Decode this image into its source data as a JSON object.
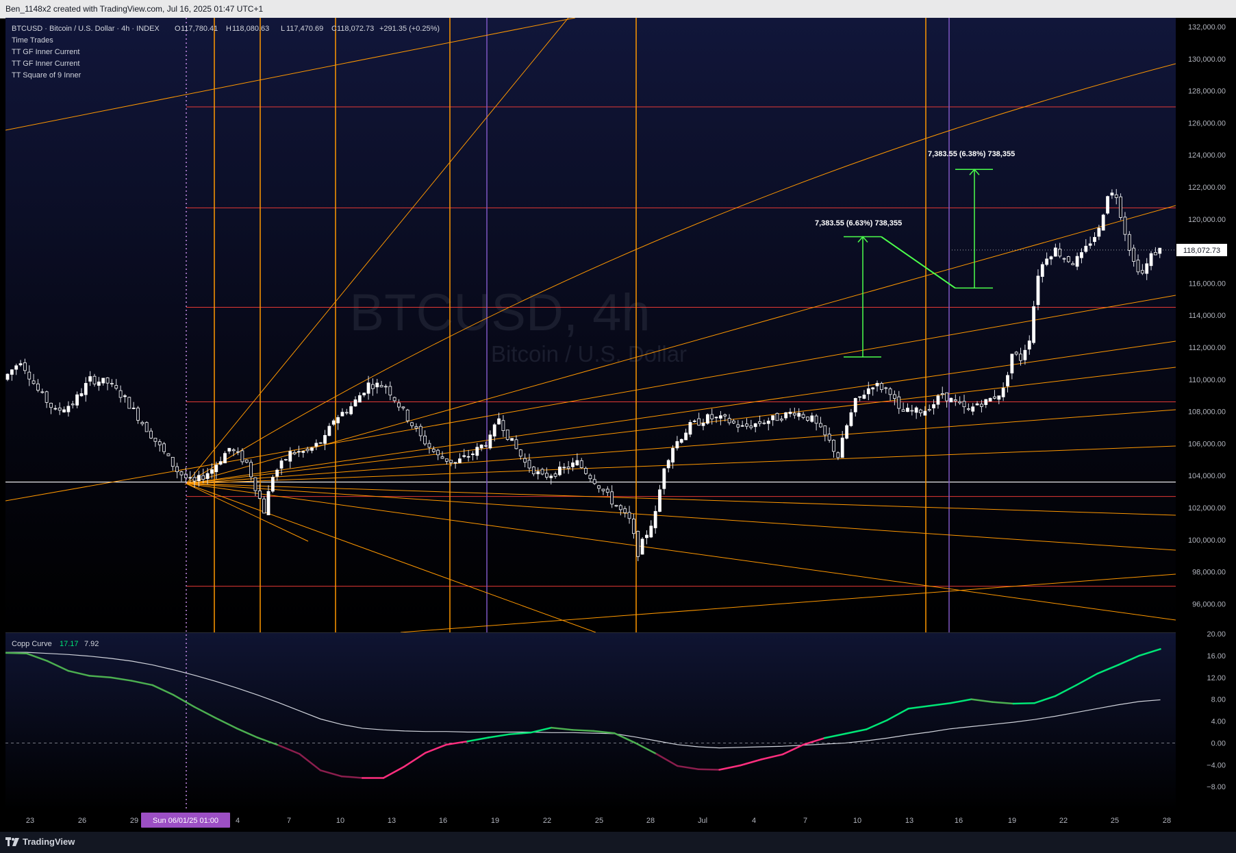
{
  "header": {
    "text": "Ben_1148x2 created with TradingView.com, Jul 16, 2025 01:47 UTC+1"
  },
  "legend": {
    "symbol": "BTCUSD · Bitcoin / U.S. Dollar · 4h · INDEX",
    "open_label": "O",
    "open": "117,780.41",
    "high_label": "H",
    "high": "118,080.63",
    "low_label": "L",
    "low": "117,470.69",
    "close_label": "C",
    "close": "118,072.73",
    "change": "+291.35 (+0.25%)",
    "indicators": [
      "Time Trades",
      "TT GF Inner Current",
      "TT GF Inner Current",
      "TT Square of 9 Inner"
    ]
  },
  "watermark": {
    "symbol": "BTCUSD, 4h",
    "name": "Bitcoin / U.S. Dollar"
  },
  "footer": {
    "brand": "TradingView"
  },
  "colors": {
    "background": "#000000",
    "orange": "#ff9800",
    "red_level": "#e53935",
    "purple_line": "#7e57c2",
    "green_measure": "#4cff4c",
    "copp_green": "#00e676",
    "copp_red": "#ff2e7e",
    "signal": "#d1d4dc"
  },
  "chart_data": [
    {
      "type": "candlestick",
      "title": "BTCUSD, 4h",
      "ylim": [
        94000,
        133000
      ],
      "yticks": [
        "132,000.00",
        "130,000.00",
        "128,000.00",
        "126,000.00",
        "124,000.00",
        "122,000.00",
        "120,000.00",
        "118,000.00",
        "116,000.00",
        "114,000.00",
        "112,000.00",
        "110,000.00",
        "108,000.00",
        "106,000.00",
        "104,000.00",
        "102,000.00",
        "100,000.00",
        "98,000.00",
        "96,000.00"
      ],
      "last_price": 118072.73,
      "last_price_label": "118,072.73",
      "x_labels": [
        "23",
        "26",
        "29",
        "Sun 06/01/25   01:00",
        "4",
        "7",
        "10",
        "13",
        "16",
        "19",
        "22",
        "25",
        "28",
        "Jul",
        "4",
        "7",
        "10",
        "13",
        "16",
        "19",
        "22",
        "25",
        "28"
      ],
      "anchor": {
        "date": "Sun 06/01/25 01:00",
        "price": 103500
      },
      "price_path": [
        [
          0,
          110000
        ],
        [
          4,
          111200
        ],
        [
          8,
          109300
        ],
        [
          12,
          108000
        ],
        [
          16,
          108500
        ],
        [
          20,
          110000
        ],
        [
          24,
          109800
        ],
        [
          28,
          108800
        ],
        [
          32,
          107300
        ],
        [
          36,
          105800
        ],
        [
          40,
          104300
        ],
        [
          43.7,
          103500
        ],
        [
          48,
          104400
        ],
        [
          52,
          105700
        ],
        [
          56,
          104800
        ],
        [
          60,
          101800
        ],
        [
          62,
          104000
        ],
        [
          66,
          105400
        ],
        [
          70,
          105500
        ],
        [
          74,
          106300
        ],
        [
          76,
          107500
        ],
        [
          80,
          108300
        ],
        [
          84,
          109700
        ],
        [
          88,
          109600
        ],
        [
          92,
          108000
        ],
        [
          96,
          106400
        ],
        [
          100,
          105200
        ],
        [
          104,
          104800
        ],
        [
          108,
          105400
        ],
        [
          112,
          106300
        ],
        [
          114,
          107600
        ],
        [
          116,
          106500
        ],
        [
          120,
          104800
        ],
        [
          124,
          103900
        ],
        [
          128,
          104300
        ],
        [
          132,
          104800
        ],
        [
          136,
          103700
        ],
        [
          140,
          102400
        ],
        [
          144,
          101200
        ],
        [
          146,
          99200
        ],
        [
          150,
          101600
        ],
        [
          152,
          104600
        ],
        [
          154,
          105800
        ],
        [
          158,
          107100
        ],
        [
          162,
          107600
        ],
        [
          166,
          107500
        ],
        [
          170,
          107000
        ],
        [
          174,
          107300
        ],
        [
          178,
          107600
        ],
        [
          182,
          108000
        ],
        [
          186,
          107500
        ],
        [
          190,
          106100
        ],
        [
          192,
          105200
        ],
        [
          194,
          107100
        ],
        [
          196,
          108600
        ],
        [
          200,
          109700
        ],
        [
          204,
          109300
        ],
        [
          206,
          108000
        ],
        [
          210,
          108000
        ],
        [
          212,
          108100
        ],
        [
          214,
          108500
        ],
        [
          216,
          109100
        ],
        [
          218,
          108700
        ],
        [
          222,
          108000
        ],
        [
          224,
          108500
        ],
        [
          226,
          108600
        ],
        [
          230,
          109300
        ],
        [
          232,
          111600
        ],
        [
          234,
          111300
        ],
        [
          236,
          112600
        ],
        [
          238,
          116600
        ],
        [
          240,
          117700
        ],
        [
          242,
          118100
        ],
        [
          244,
          117600
        ],
        [
          246,
          117300
        ],
        [
          248,
          117700
        ],
        [
          250,
          118600
        ],
        [
          252,
          119300
        ],
        [
          254,
          121600
        ],
        [
          256,
          121500
        ],
        [
          258,
          119200
        ],
        [
          260,
          117300
        ],
        [
          262,
          116600
        ],
        [
          264,
          117700
        ],
        [
          265.6,
          118072
        ]
      ],
      "levels_red": [
        127000,
        120700,
        114500,
        108600,
        102700,
        97100
      ],
      "level_white": 103600,
      "vertical_orange_dates": [
        62,
        57,
        74,
        96,
        146,
        210
      ],
      "vertical_orange_x_idx": [
        8.0,
        18.0,
        34.0,
        95.0,
        135.0,
        255.0
      ],
      "vertical_purple_x_idx": [
        103.0,
        260.5
      ],
      "measure_1": {
        "label": "7,383.55 (6.63%) 738,355",
        "from_price": 111400,
        "to_price": 118900
      },
      "measure_2": {
        "label": "7,383.55 (6.38%) 738,355",
        "from_price": 115700,
        "to_price": 123100
      }
    },
    {
      "type": "line",
      "title": "Copp Curve",
      "values_label": [
        "17.17",
        "7.92"
      ],
      "ylim": [
        -10,
        20
      ],
      "yticks": [
        "20.00",
        "16.00",
        "12.00",
        "8.00",
        "4.00",
        "0.00",
        "−4.00",
        "−8.00"
      ],
      "series": [
        {
          "name": "Copp Curve",
          "values": [
            16.5,
            16.4,
            15.0,
            13.2,
            12.3,
            12.0,
            11.4,
            10.6,
            8.8,
            6.6,
            4.6,
            2.7,
            1.0,
            -0.4,
            -2.0,
            -5.0,
            -6.1,
            -6.4,
            -6.4,
            -4.3,
            -1.8,
            -0.3,
            0.3,
            1.0,
            1.6,
            1.9,
            2.8,
            2.4,
            2.2,
            1.8,
            0.0,
            -2.0,
            -4.2,
            -4.8,
            -4.9,
            -4.1,
            -3.0,
            -2.1,
            -0.3,
            0.9,
            1.7,
            2.5,
            4.2,
            6.3,
            6.8,
            7.3,
            8.0,
            7.5,
            7.2,
            7.3,
            8.6,
            10.6,
            12.7,
            14.3,
            16.0,
            17.2
          ]
        },
        {
          "name": "Signal",
          "values": [
            16.6,
            16.6,
            16.4,
            16.2,
            15.9,
            15.5,
            15.0,
            14.3,
            13.4,
            12.4,
            11.3,
            10.1,
            8.8,
            7.4,
            5.9,
            4.4,
            3.4,
            2.7,
            2.4,
            2.2,
            2.1,
            2.1,
            2.0,
            2.0,
            2.0,
            2.0,
            1.9,
            1.9,
            1.8,
            1.7,
            1.1,
            0.4,
            -0.3,
            -0.7,
            -0.9,
            -0.8,
            -0.7,
            -0.6,
            -0.4,
            -0.2,
            0.0,
            0.4,
            0.9,
            1.5,
            2.0,
            2.6,
            3.0,
            3.4,
            3.8,
            4.3,
            4.9,
            5.6,
            6.3,
            7.0,
            7.6,
            7.9
          ]
        }
      ]
    }
  ]
}
